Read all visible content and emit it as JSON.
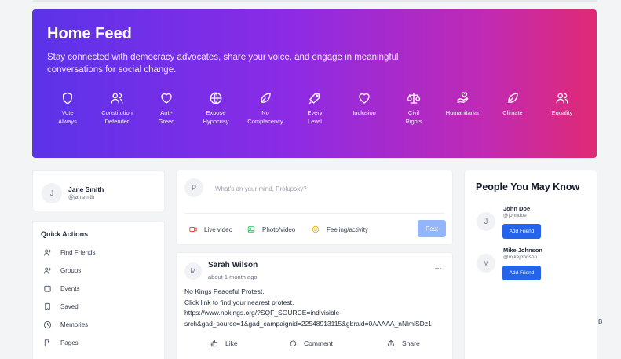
{
  "hero": {
    "title": "Home Feed",
    "subtitle": "Stay connected with democracy advocates, share your voice, and engage in meaningful conversations for social change.",
    "categories": [
      {
        "label": "Vote\nAlways",
        "icon": "shield-icon"
      },
      {
        "label": "Constitution\nDefender",
        "icon": "users-icon"
      },
      {
        "label": "Anti-\nGreed",
        "icon": "heart-icon"
      },
      {
        "label": "Expose\nHypocrisy",
        "icon": "globe-icon"
      },
      {
        "label": "No\nComplacency",
        "icon": "leaf-icon"
      },
      {
        "label": "Every\nLevel",
        "icon": "tag-icon"
      },
      {
        "label": "Inclusion",
        "icon": "heart-icon"
      },
      {
        "label": "Civil\nRights",
        "icon": "scales-icon"
      },
      {
        "label": "Humanitarian",
        "icon": "hand-heart-icon"
      },
      {
        "label": "Climate",
        "icon": "leaf-icon"
      },
      {
        "label": "Equality",
        "icon": "users-icon"
      }
    ]
  },
  "profile": {
    "initial": "J",
    "name": "Jane Smith",
    "handle": "@jansmith"
  },
  "quick_actions": {
    "title": "Quick Actions",
    "items": [
      {
        "label": "Find Friends",
        "icon": "users-icon"
      },
      {
        "label": "Groups",
        "icon": "users-icon"
      },
      {
        "label": "Events",
        "icon": "calendar-icon"
      },
      {
        "label": "Saved",
        "icon": "bookmark-icon"
      },
      {
        "label": "Memories",
        "icon": "clock-icon"
      },
      {
        "label": "Pages",
        "icon": "flag-icon"
      }
    ]
  },
  "composer": {
    "initial": "P",
    "placeholder": "What's on your mind, Prolupsky?",
    "actions": [
      {
        "label": "Live video",
        "icon": "video-icon",
        "color": "#ef4444"
      },
      {
        "label": "Photo/video",
        "icon": "image-icon",
        "color": "#22c55e"
      },
      {
        "label": "Feeling/activity",
        "icon": "smile-icon",
        "color": "#eab308"
      }
    ],
    "post_label": "Post"
  },
  "post": {
    "initial": "M",
    "author": "Sarah Wilson",
    "time": "about 1 month ago",
    "more": "···",
    "lines": [
      "No Kings Peaceful Protest.",
      "Click link to find your nearest protest.",
      "https://www.nokings.org/?SQF_SOURCE=indivisible-",
      "srch&gad_source=1&gad_campaignid=22548913115&gbraid=0AAAAA_nNlmiSDz1"
    ],
    "actions": {
      "like": "Like",
      "comment": "Comment",
      "share": "Share"
    }
  },
  "people": {
    "title": "People You May Know",
    "items": [
      {
        "initial": "J",
        "name": "John Doe",
        "handle": "@johndoe",
        "button": "Add Friend"
      },
      {
        "initial": "M",
        "name": "Mike Johnson",
        "handle": "@mikejohnson",
        "button": "Add Friend"
      }
    ]
  },
  "edge_text": "B",
  "colors": {
    "primary": "#2563eb",
    "post_disabled": "#93b5f9",
    "gradient_start": "#5b33e8",
    "gradient_end": "#e02a74"
  }
}
